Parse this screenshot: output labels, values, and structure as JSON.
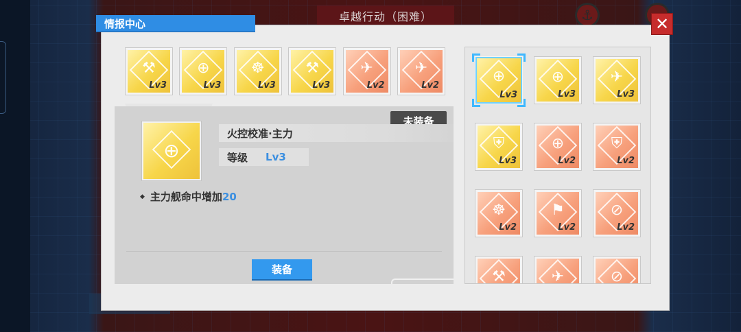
{
  "background": {
    "top_banner": "卓越行动（困难）"
  },
  "dialog": {
    "title": "情报中心",
    "close_label": "✕"
  },
  "top_tiles": [
    {
      "style": "gold",
      "icon": "cannon-icon",
      "glyph": "⚒",
      "level": "Lv3"
    },
    {
      "style": "gold",
      "icon": "gun-target-icon",
      "glyph": "⊕",
      "level": "Lv3"
    },
    {
      "style": "gold",
      "icon": "helm-wheel-icon",
      "glyph": "☸",
      "level": "Lv3"
    },
    {
      "style": "gold",
      "icon": "cannon-icon",
      "glyph": "⚒",
      "level": "Lv3"
    },
    {
      "style": "orange",
      "icon": "plane-icon",
      "glyph": "✈",
      "level": "Lv2"
    },
    {
      "style": "orange",
      "icon": "plane-up-icon",
      "glyph": "✈",
      "level": "Lv2"
    }
  ],
  "detail": {
    "status": "未装备",
    "name": "火控校准·主力",
    "level_label": "等级",
    "level_value": "Lv3",
    "icon": "crosshair-up-icon",
    "effect_text": "主力舰命中增加",
    "effect_value": "20",
    "equip_button": "装备"
  },
  "grid_tiles": [
    {
      "style": "gold",
      "icon": "crosshair-icon",
      "glyph": "⊕",
      "level": "Lv3",
      "selected": true
    },
    {
      "style": "gold",
      "icon": "gun-target-icon",
      "glyph": "⊕",
      "level": "Lv3"
    },
    {
      "style": "gold",
      "icon": "plane-icon",
      "glyph": "✈",
      "level": "Lv3"
    },
    {
      "style": "gold",
      "icon": "shield-icon",
      "glyph": "⛨",
      "level": "Lv3"
    },
    {
      "style": "orange",
      "icon": "gun-target-icon",
      "glyph": "⊕",
      "level": "Lv2"
    },
    {
      "style": "orange",
      "icon": "shield-icon",
      "glyph": "⛨",
      "level": "Lv2"
    },
    {
      "style": "orange",
      "icon": "helm-wheel-icon",
      "glyph": "☸",
      "level": "Lv2"
    },
    {
      "style": "orange",
      "icon": "shells-icon",
      "glyph": "⚑",
      "level": "Lv2"
    },
    {
      "style": "orange",
      "icon": "torpedo-icon",
      "glyph": "⊘",
      "level": "Lv2"
    },
    {
      "style": "orange",
      "icon": "cannon-icon",
      "glyph": "⚒",
      "level": ""
    },
    {
      "style": "orange",
      "icon": "plane-icon",
      "glyph": "✈",
      "level": ""
    },
    {
      "style": "orange",
      "icon": "torpedo-icon",
      "glyph": "⊘",
      "level": ""
    }
  ]
}
